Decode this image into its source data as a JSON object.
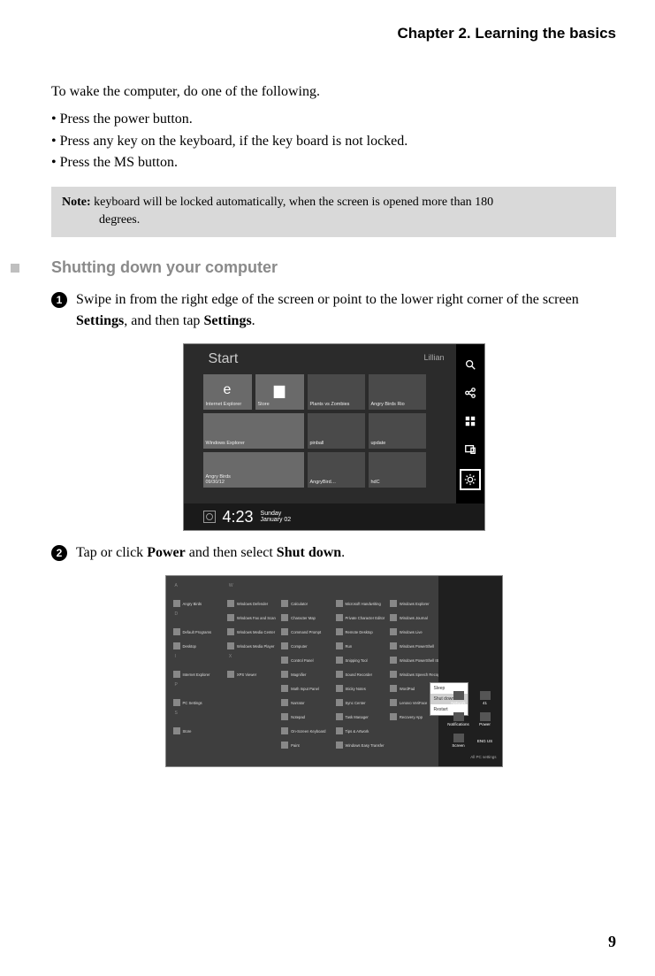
{
  "chapter": "Chapter 2. Learning the basics",
  "intro": "To wake the computer, do one of the following.",
  "bullets": [
    "• Press the power button.",
    "• Press any key on the keyboard, if the key board is not locked.",
    "• Press the MS button."
  ],
  "note": {
    "label": "Note:",
    "line1": " keyboard will be locked automatically, when the screen is opened more than 180",
    "line2": "degrees."
  },
  "section_heading": "Shutting down your computer",
  "step1": {
    "num": "1",
    "pre": "Swipe in from the right edge of the screen or point to the lower right corner of the screen ",
    "b1": "Settings",
    "mid": ", and then tap ",
    "b2": "Settings",
    "post": "."
  },
  "step2": {
    "num": "2",
    "pre": "Tap or click ",
    "b1": "Power",
    "mid": " and then select  ",
    "b2": "Shut down",
    "post": "."
  },
  "screenshot1": {
    "start": "Start",
    "user": "Lillian",
    "time": "4:23",
    "day": "Sunday",
    "date": "January 02",
    "tiles": {
      "ie": "Internet Explorer",
      "store": "Store",
      "plants": "Plants vs Zombies",
      "angry": "Angry Birds Rio",
      "wexp": "Windows Explorer",
      "pin": "pinball",
      "upd": "update",
      "angryred": "AngryBird…",
      "hdc": "hdC",
      "ablabel": "Angry Birds",
      "date2": "09/30/12"
    },
    "charms": {
      "search": "Search",
      "share": "Share",
      "start": "Start",
      "devices": "Devices",
      "settings": "Settings"
    }
  },
  "screenshot2": {
    "letters": [
      "A",
      "D",
      "I",
      "P",
      "S",
      "W",
      "X"
    ],
    "apps": [
      "Angry Birds",
      "Default Programs",
      "Desktop",
      "Internet Explorer",
      "PC Settings",
      "Store",
      "Windows Defender",
      "Windows Fax and Scan",
      "Windows Media Center",
      "Windows Media Player",
      "XPS Viewer",
      "Calculator",
      "Character Map",
      "Command Prompt",
      "Computer",
      "Control Panel",
      "Magnifier",
      "Math Input Panel",
      "Narrator",
      "Notepad",
      "On-Screen Keyboard",
      "Paint",
      "Microsoft Handwriting",
      "Private Character Editor",
      "Remote Desktop",
      "Run",
      "Snipping Tool",
      "Sound Recorder",
      "Sticky Notes",
      "Sync Center",
      "Task Manager",
      "Tips & Artwork",
      "Windows Easy Transfer",
      "Windows Explorer",
      "Windows Journal",
      "Windows Live",
      "Windows PowerShell",
      "Windows PowerShell ISE",
      "Windows Speech Recognition",
      "WordPad",
      "Lenovo VeriFace",
      "Recovery App"
    ],
    "popup": {
      "sleep": "Sleep",
      "shutdown": "Shut down",
      "restart": "Restart"
    },
    "panel": {
      "net": "Network",
      "vol": "41",
      "scr": "Screen",
      "not": "Notifications",
      "pow": "Power",
      "kbd": "ENG US",
      "row_l": "Notifications",
      "row_r": "Power",
      "pc": "All PC settings"
    }
  },
  "page_number": "9"
}
